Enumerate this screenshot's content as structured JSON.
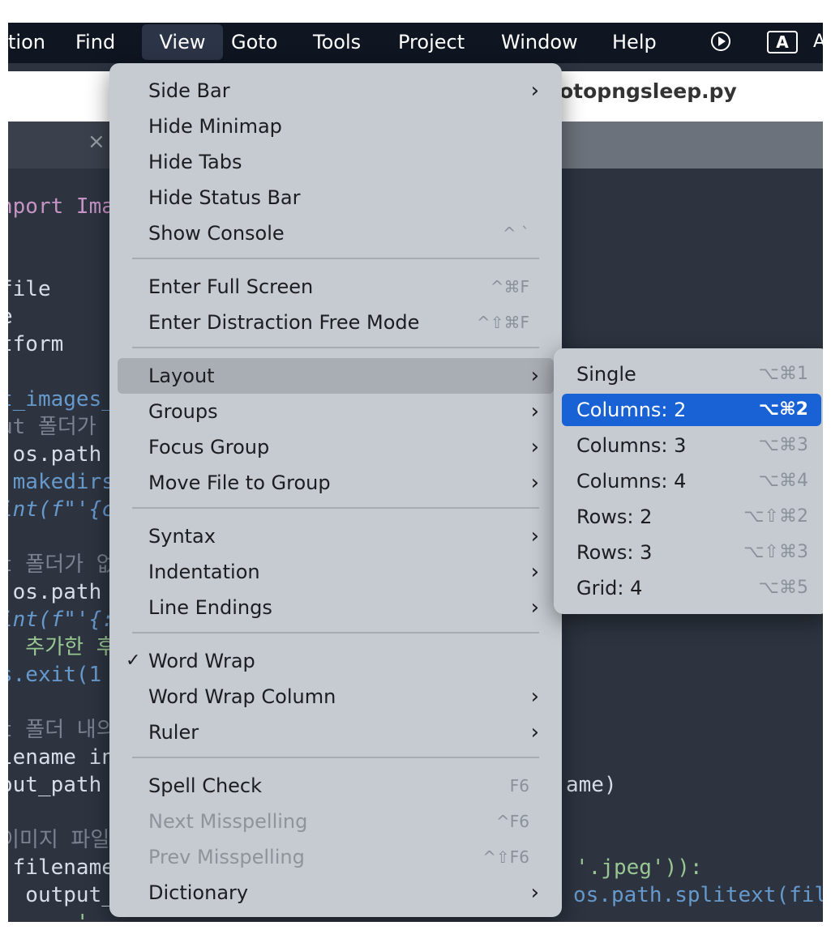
{
  "menubar": {
    "items": [
      "tion",
      "Find",
      "View",
      "Goto",
      "Tools",
      "Project",
      "Window",
      "Help"
    ],
    "kbd_icon": "A",
    "trailing": "A"
  },
  "editor": {
    "filename": "otopngsleep.py",
    "code_lines": [
      "nport Ima",
      "file",
      "e",
      "tform",
      "t_images_",
      "ut 폴더가",
      " os.path",
      ".makedirs",
      "int(f\"'{c",
      "t 폴더가 없",
      " os.path",
      "int(f\"'{:",
      "  추가한 후",
      "s.exit(1",
      "t 폴더 내의",
      "lename in",
      "out_path",
      "이미지 파일",
      " filename",
      "  output_",
      "      '"
    ],
    "right_fragments": [
      "ame)",
      "'.jpeg')):",
      "os.path.splitext(fil"
    ]
  },
  "view_menu": {
    "items": [
      {
        "label": "Side Bar",
        "shortcut": "",
        "submenu": true,
        "check": "",
        "disabled": false
      },
      {
        "label": "Hide Minimap",
        "shortcut": "",
        "submenu": false,
        "check": "",
        "disabled": false
      },
      {
        "label": "Hide Tabs",
        "shortcut": "",
        "submenu": false,
        "check": "",
        "disabled": false
      },
      {
        "label": "Hide Status Bar",
        "shortcut": "",
        "submenu": false,
        "check": "",
        "disabled": false
      },
      {
        "label": "Show Console",
        "shortcut": "^ `",
        "submenu": false,
        "check": "",
        "disabled": false
      },
      {
        "label": "Enter Full Screen",
        "shortcut": "^⌘F",
        "submenu": false,
        "check": "",
        "disabled": false
      },
      {
        "label": "Enter Distraction Free Mode",
        "shortcut": "^⇧⌘F",
        "submenu": false,
        "check": "",
        "disabled": false
      },
      {
        "label": "Layout",
        "shortcut": "",
        "submenu": true,
        "check": "",
        "disabled": false
      },
      {
        "label": "Groups",
        "shortcut": "",
        "submenu": true,
        "check": "",
        "disabled": false
      },
      {
        "label": "Focus Group",
        "shortcut": "",
        "submenu": true,
        "check": "",
        "disabled": false
      },
      {
        "label": "Move File to Group",
        "shortcut": "",
        "submenu": true,
        "check": "",
        "disabled": false
      },
      {
        "label": "Syntax",
        "shortcut": "",
        "submenu": true,
        "check": "",
        "disabled": false
      },
      {
        "label": "Indentation",
        "shortcut": "",
        "submenu": true,
        "check": "",
        "disabled": false
      },
      {
        "label": "Line Endings",
        "shortcut": "",
        "submenu": true,
        "check": "",
        "disabled": false
      },
      {
        "label": "Word Wrap",
        "shortcut": "",
        "submenu": false,
        "check": "✓",
        "disabled": false
      },
      {
        "label": "Word Wrap Column",
        "shortcut": "",
        "submenu": true,
        "check": "",
        "disabled": false
      },
      {
        "label": "Ruler",
        "shortcut": "",
        "submenu": true,
        "check": "",
        "disabled": false
      },
      {
        "label": "Spell Check",
        "shortcut": "F6",
        "submenu": false,
        "check": "",
        "disabled": false
      },
      {
        "label": "Next Misspelling",
        "shortcut": "^F6",
        "submenu": false,
        "check": "",
        "disabled": true
      },
      {
        "label": "Prev Misspelling",
        "shortcut": "^⇧F6",
        "submenu": false,
        "check": "",
        "disabled": true
      },
      {
        "label": "Dictionary",
        "shortcut": "",
        "submenu": true,
        "check": "",
        "disabled": false
      }
    ]
  },
  "layout_submenu": {
    "items": [
      {
        "label": "Single",
        "shortcut": "⌥⌘1"
      },
      {
        "label": "Columns: 2",
        "shortcut": "⌥⌘2",
        "selected": true
      },
      {
        "label": "Columns: 3",
        "shortcut": "⌥⌘3"
      },
      {
        "label": "Columns: 4",
        "shortcut": "⌥⌘4"
      },
      {
        "label": "Rows: 2",
        "shortcut": "⌥⇧⌘2"
      },
      {
        "label": "Rows: 3",
        "shortcut": "⌥⇧⌘3"
      },
      {
        "label": "Grid: 4",
        "shortcut": "⌥⌘5"
      }
    ]
  },
  "colors": {
    "menubar_bg": "#0f1521",
    "menu_bg": "#c5cbd1",
    "selection": "#1962d6",
    "editor_bg": "#2d3440"
  }
}
